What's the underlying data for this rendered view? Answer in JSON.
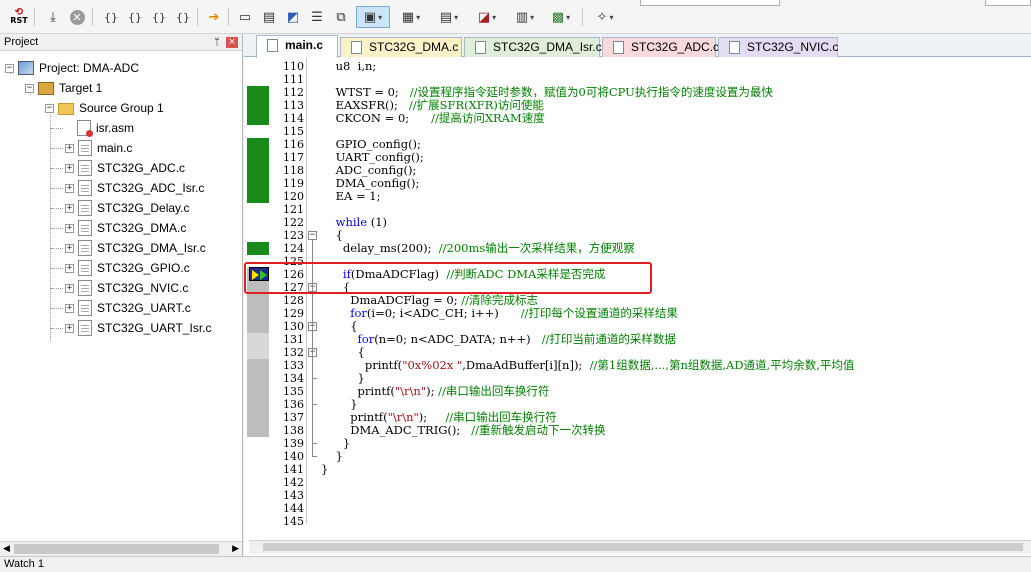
{
  "toolbar": {
    "icons": [
      "rst-icon",
      "download-icon",
      "stop-icon",
      "step-into-icon",
      "step-over-icon",
      "step-out-icon",
      "run-to-cursor-icon",
      "show-next-statement-icon",
      "command-window-icon",
      "disassembly-icon",
      "symbols-icon",
      "registers-icon",
      "call-stack-icon",
      "watch-icon",
      "memory-icon",
      "serial-icon",
      "analysis-icon",
      "trace-icon",
      "system-viewer-icon",
      "toolbox-icon",
      "settings-icon"
    ],
    "rst_label": "RST"
  },
  "project": {
    "panel_title": "Project",
    "pin": "ᛘ",
    "close": "×",
    "root": "Project: DMA-ADC",
    "target": "Target 1",
    "group": "Source Group 1",
    "files": [
      "isr.asm",
      "main.c",
      "STC32G_ADC.c",
      "STC32G_ADC_Isr.c",
      "STC32G_Delay.c",
      "STC32G_DMA.c",
      "STC32G_DMA_Isr.c",
      "STC32G_GPIO.c",
      "STC32G_NVIC.c",
      "STC32G_UART.c",
      "STC32G_UART_Isr.c"
    ]
  },
  "tabs": [
    {
      "label": "main.c",
      "color": "#ffffff",
      "active": true
    },
    {
      "label": "STC32G_DMA.c",
      "color": "#fdf1c8",
      "active": false
    },
    {
      "label": "STC32G_DMA_Isr.c",
      "color": "#dfeed8",
      "active": false
    },
    {
      "label": "STC32G_ADC.c",
      "color": "#f8d9dc",
      "active": false
    },
    {
      "label": "STC32G_NVIC.c",
      "color": "#e4dcf2",
      "active": false
    }
  ],
  "editor": {
    "line_numbers": [
      "110",
      "111",
      "112",
      "113",
      "114",
      "115",
      "116",
      "117",
      "118",
      "119",
      "120",
      "121",
      "122",
      "123",
      "124",
      "125",
      "126",
      "127",
      "128",
      "129",
      "130",
      "131",
      "132",
      "133",
      "134",
      "135",
      "136",
      "137",
      "138",
      "139",
      "140",
      "141",
      "142",
      "143",
      "144",
      "145"
    ],
    "lines": [
      {
        "code": "    u8  i,n;"
      },
      {
        "code": ""
      },
      {
        "code": "    WTST = 0;   ",
        "comment": "//设置程序指令延时参数，赋值为0可将CPU执行指令的速度设置为最快"
      },
      {
        "code": "    EAXSFR();   ",
        "comment": "//扩展SFR(XFR)访问使能"
      },
      {
        "code": "    CKCON = 0;      ",
        "comment": "//提高访问XRAM速度"
      },
      {
        "code": ""
      },
      {
        "code": "    GPIO_config();"
      },
      {
        "code": "    UART_config();"
      },
      {
        "code": "    ADC_config();"
      },
      {
        "code": "    DMA_config();"
      },
      {
        "code": "    EA = 1;"
      },
      {
        "code": ""
      },
      {
        "kw": "    while",
        "code": " (1)"
      },
      {
        "code": "    {"
      },
      {
        "code": "      delay_ms(200);  ",
        "comment": "//200ms输出一次采样结果，方便观察"
      },
      {
        "code": ""
      },
      {
        "kw": "      if",
        "code": "(DmaADCFlag)  ",
        "comment": "//判断ADC DMA采样是否完成"
      },
      {
        "code": "      {"
      },
      {
        "code": "        DmaADCFlag = 0; ",
        "comment": "//清除完成标志"
      },
      {
        "kw": "        for",
        "code": "(i=0; i<ADC_CH; i++)      ",
        "comment": "//打印每个设置通道的采样结果"
      },
      {
        "code": "        {"
      },
      {
        "kw": "          for",
        "code": "(n=0; n<ADC_DATA; n++)   ",
        "comment": "//打印当前通道的采样数据"
      },
      {
        "code": "          {"
      },
      {
        "code": "            printf(",
        "str": "\"0x%02x \"",
        "code2": ",DmaAdBuffer[i][n]);  ",
        "comment": "//第1组数据,...,第n组数据,AD通道,平均余数,平均值"
      },
      {
        "code": "          }"
      },
      {
        "code": "          printf(",
        "str": "\"\\r\\n\"",
        "code2": "); ",
        "comment": "//串口输出回车换行符"
      },
      {
        "code": "        }"
      },
      {
        "code": "        printf(",
        "str": "\"\\r\\n\"",
        "code2": ");     ",
        "comment": "//串口输出回车换行符"
      },
      {
        "code": "        DMA_ADC_TRIG();   ",
        "comment": "//重新触发启动下一次转换"
      },
      {
        "code": "      }"
      },
      {
        "code": "    }"
      },
      {
        "code": "}"
      },
      {
        "code": ""
      },
      {
        "code": ""
      },
      {
        "code": ""
      },
      {
        "code": ""
      }
    ]
  },
  "bottom_panel": {
    "label": "Watch 1"
  }
}
